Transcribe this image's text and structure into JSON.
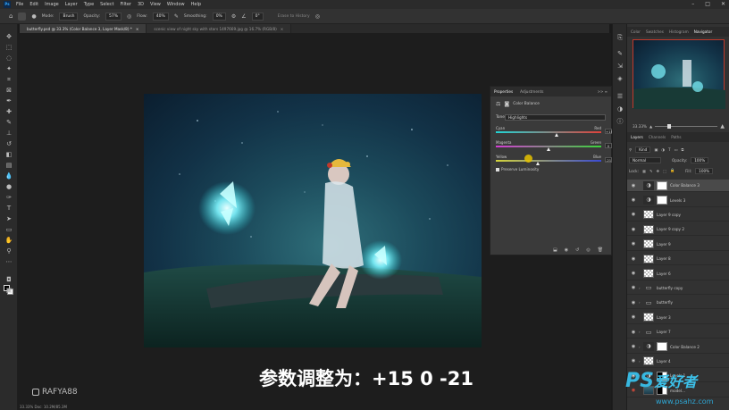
{
  "menu": {
    "app_logo": "Ps",
    "items": [
      "File",
      "Edit",
      "Image",
      "Layer",
      "Type",
      "Select",
      "Filter",
      "3D",
      "View",
      "Window",
      "Help"
    ],
    "window_controls": [
      "–",
      "□",
      "✕"
    ]
  },
  "options_bar": {
    "mode_label": "Mode:",
    "mode_value": "Brush",
    "opacity_label": "Opacity:",
    "opacity_value": "57%",
    "flow_label": "Flow:",
    "flow_value": "40%",
    "smoothing_label": "Smoothing:",
    "smoothing_value": "0%",
    "angle_value": "0°",
    "erase_label": "Erase to History"
  },
  "tabs": [
    {
      "label": "butterfly.psd @ 33.3% (Color Balance 3, Layer Mask/8) *",
      "close": "×"
    },
    {
      "label": "scenic view of night sky with stars 1497669.jpg @ 16.7% (RGB/8)",
      "close": "×"
    }
  ],
  "properties": {
    "tab_properties": "Properties",
    "tab_adjustments": "Adjustments",
    "panel_controls": ">> ≡",
    "title": "Color Balance",
    "tone_label": "Tone:",
    "tone_value": "Highlights",
    "sliders": [
      {
        "left": "Cyan",
        "right": "Red",
        "value": "+15",
        "fraction": 0.58,
        "track": "track-cr"
      },
      {
        "left": "Magenta",
        "right": "Green",
        "value": "0",
        "fraction": 0.5,
        "track": "track-mg"
      },
      {
        "left": "Yellow",
        "right": "Blue",
        "value": "-21",
        "fraction": 0.4,
        "track": "track-yb"
      }
    ],
    "preserve_label": "Preserve Luminosity"
  },
  "right_panel": {
    "top_tabs": [
      "Color",
      "Swatches",
      "Histogram",
      "Navigator"
    ],
    "active_top_tab": "Navigator",
    "zoom_value": "33.33%",
    "layer_tabs": [
      "Layers",
      "Channels",
      "Paths"
    ],
    "kind_label": "Kind",
    "blend_mode": "Normal",
    "opacity_label": "Opacity:",
    "opacity_value": "100%",
    "lock_label": "Lock:",
    "fill_label": "Fill:",
    "fill_value": "100%"
  },
  "layers": [
    {
      "name": "Color Balance 3",
      "thumb": "adj",
      "mask": "white",
      "selected": true,
      "eye_red": false,
      "chev": false
    },
    {
      "name": "Levels 3",
      "thumb": "adj",
      "mask": "white",
      "selected": false,
      "eye_red": false,
      "chev": false
    },
    {
      "name": "Layer 9 copy",
      "thumb": "checker",
      "mask": "",
      "selected": false,
      "eye_red": false,
      "chev": false
    },
    {
      "name": "Layer 9 copy 2",
      "thumb": "checker",
      "mask": "",
      "selected": false,
      "eye_red": false,
      "chev": false
    },
    {
      "name": "Layer 9",
      "thumb": "checker",
      "mask": "",
      "selected": false,
      "eye_red": false,
      "chev": false
    },
    {
      "name": "Layer 8",
      "thumb": "checker",
      "mask": "",
      "selected": false,
      "eye_red": false,
      "chev": false
    },
    {
      "name": "Layer 6",
      "thumb": "checker",
      "mask": "",
      "selected": false,
      "eye_red": false,
      "chev": false
    },
    {
      "name": "butterfly copy",
      "thumb": "folder",
      "mask": "",
      "selected": false,
      "eye_red": false,
      "chev": true
    },
    {
      "name": "butterfly",
      "thumb": "folder",
      "mask": "",
      "selected": false,
      "eye_red": false,
      "chev": true
    },
    {
      "name": "Layer 3",
      "thumb": "checker",
      "mask": "",
      "selected": false,
      "eye_red": false,
      "chev": false
    },
    {
      "name": "Layer 7",
      "thumb": "folder",
      "mask": "",
      "selected": false,
      "eye_red": false,
      "chev": true
    },
    {
      "name": "Color Balance 2",
      "thumb": "adj",
      "mask": "white",
      "selected": false,
      "eye_red": false,
      "chev": true
    },
    {
      "name": "Layer 4",
      "thumb": "checker",
      "mask": "",
      "selected": false,
      "eye_red": false,
      "chev": true
    },
    {
      "name": "Levels 1",
      "thumb": "adj",
      "mask": "bw",
      "selected": false,
      "eye_red": false,
      "chev": true
    },
    {
      "name": "model...",
      "thumb": "photo",
      "mask": "bw",
      "selected": false,
      "eye_red": true,
      "chev": false
    }
  ],
  "caption": "参数调整为：+15 0 -21",
  "watermark": "RAFYA88",
  "site_logo": {
    "ps": "PS",
    "cn": "爱好者",
    "url": "www.psahz.com"
  },
  "status": "33.33%   Doc: 10.2M/85.3M",
  "colors": {
    "accent": "#31a8ff",
    "selection_border": "#c0392b",
    "glow": "#7ff5ff"
  }
}
